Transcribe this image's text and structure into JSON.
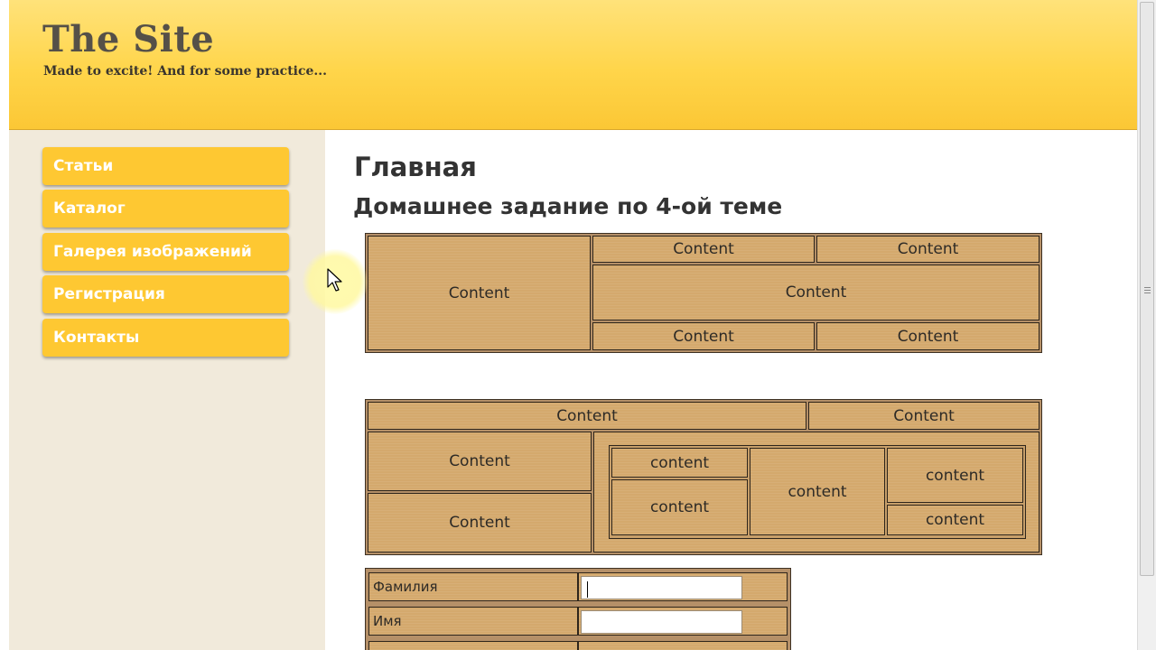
{
  "header": {
    "site_title": "The Site",
    "slogan": "Made to excite! And for some practice..."
  },
  "sidebar": {
    "items": [
      {
        "label": "Статьи"
      },
      {
        "label": "Каталог"
      },
      {
        "label": "Галерея изображений"
      },
      {
        "label": "Регистрация"
      },
      {
        "label": "Контакты"
      }
    ]
  },
  "main": {
    "title": "Главная",
    "subtitle": "Домашнее задание по 4-ой теме",
    "table1": {
      "cells": [
        "Content",
        "Content",
        "Content",
        "Content",
        "Content",
        "Content"
      ]
    },
    "table2": {
      "cells": [
        "Content",
        "Content",
        "Content",
        "Content"
      ],
      "nested": [
        "content",
        "content",
        "content",
        "content",
        "content"
      ]
    },
    "form": {
      "labels": [
        "Фамилия",
        "Имя"
      ],
      "values": [
        "",
        ""
      ]
    }
  },
  "colors": {
    "header_top": "#ffe27a",
    "header_bottom": "#fbc735",
    "nav_button": "#fec832",
    "sidebar_bg": "#f1eadb",
    "cell_bg": "#d4a96d"
  }
}
